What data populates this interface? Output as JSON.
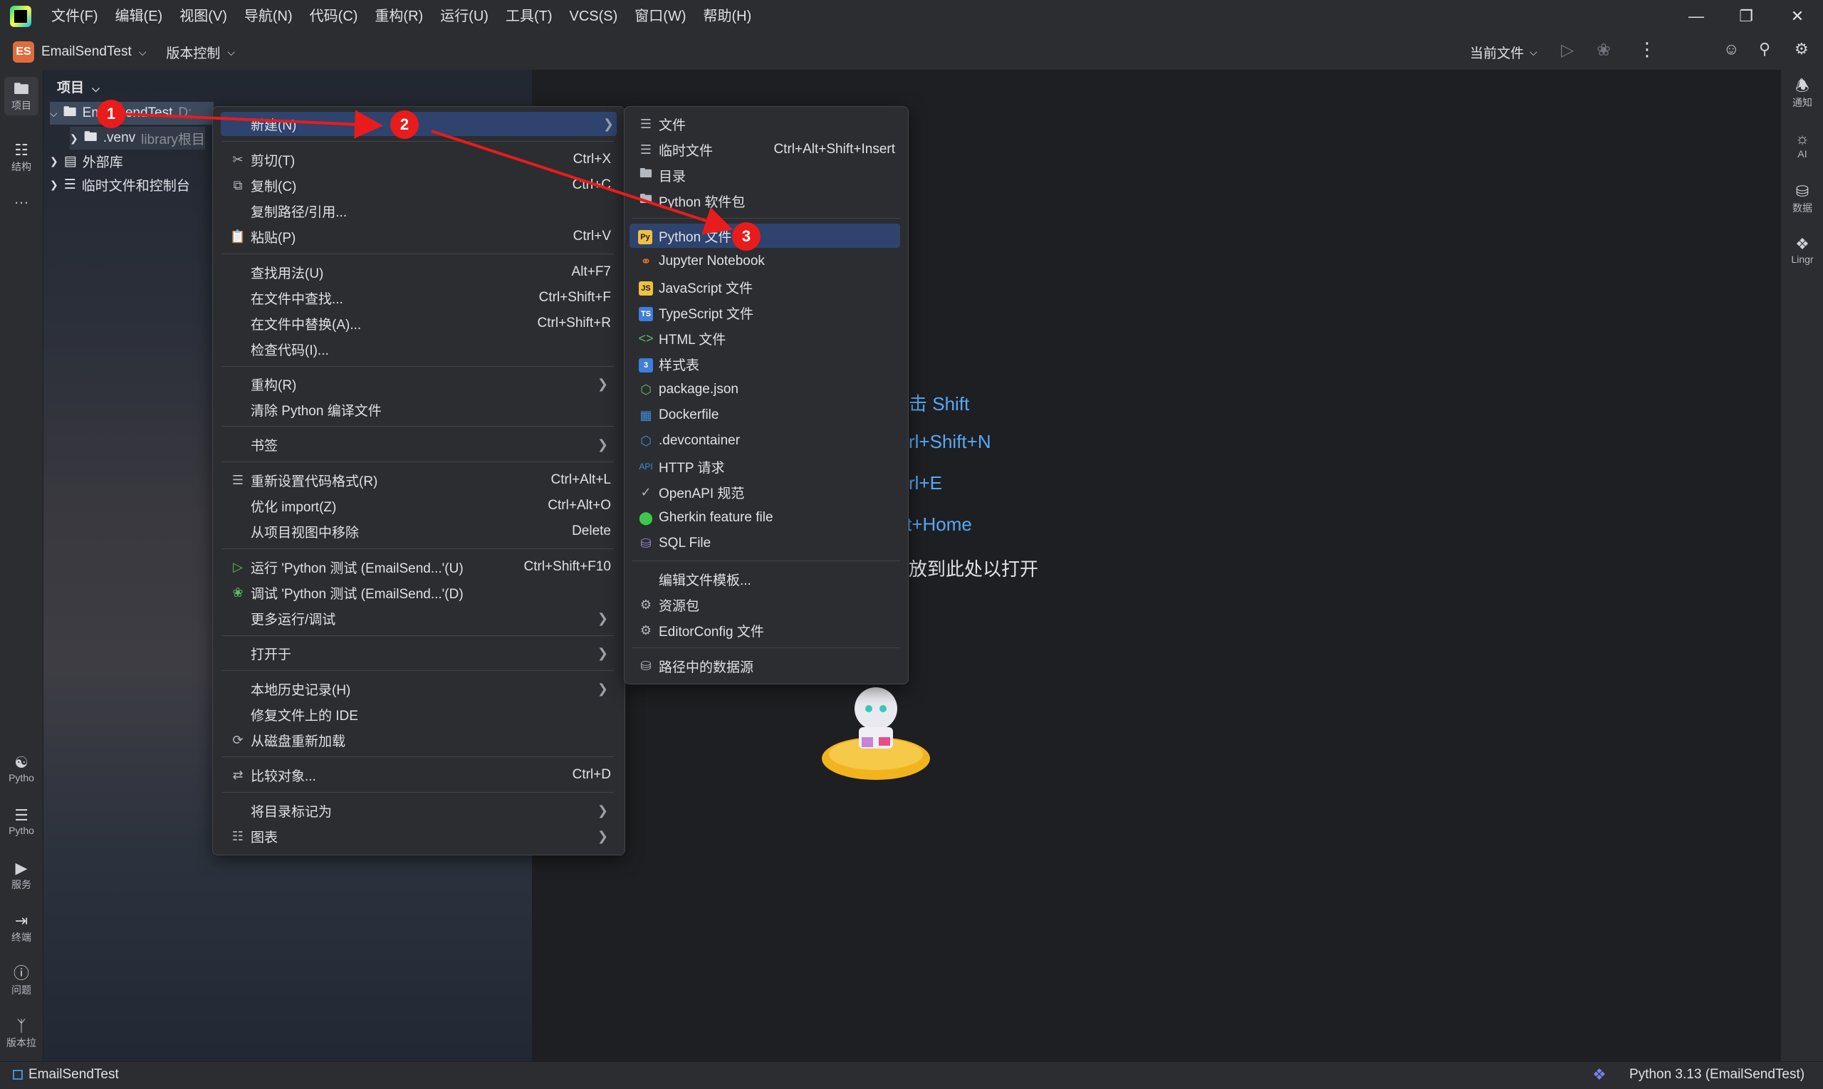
{
  "menubar": {
    "items": [
      "文件(F)",
      "编辑(E)",
      "视图(V)",
      "导航(N)",
      "代码(C)",
      "重构(R)",
      "运行(U)",
      "工具(T)",
      "VCS(S)",
      "窗口(W)",
      "帮助(H)"
    ]
  },
  "toolbar": {
    "project_badge": "ES",
    "project_name": "EmailSendTest",
    "vcs_label": "版本控制",
    "run_config": "当前文件"
  },
  "left_strip": {
    "project": "项目",
    "structure": "结构",
    "more": "…",
    "python_console": "Pytho",
    "python_packages": "Pytho",
    "services": "服务",
    "terminal": "终端",
    "problems": "问题",
    "vcs": "版本拉"
  },
  "right_strip": {
    "notifications": "通知",
    "ai": "AI",
    "database": "数据",
    "lingma": "Lingr"
  },
  "project_panel": {
    "header": "项目",
    "root_name": "EmailSendTest",
    "root_path": "D:",
    "venv_name": ".venv",
    "venv_suffix": "library根目",
    "external_libs": "外部库",
    "scratches": "临时文件和控制台"
  },
  "editor_hints": {
    "line1": "双击 Shift",
    "line2": "Ctrl+Shift+N",
    "line3": "Ctrl+E",
    "line4": "Alt+Home",
    "line5": "拖放到此处以打开"
  },
  "context_menu": {
    "new": "新建(N)",
    "cut": "剪切(T)",
    "cut_sc": "Ctrl+X",
    "copy": "复制(C)",
    "copy_sc": "Ctrl+C",
    "copy_path": "复制路径/引用...",
    "paste": "粘贴(P)",
    "paste_sc": "Ctrl+V",
    "find_usages": "查找用法(U)",
    "find_usages_sc": "Alt+F7",
    "find_in_files": "在文件中查找...",
    "find_in_files_sc": "Ctrl+Shift+F",
    "replace_in_files": "在文件中替换(A)...",
    "replace_in_files_sc": "Ctrl+Shift+R",
    "inspect_code": "检查代码(I)...",
    "refactor": "重构(R)",
    "clean_python": "清除 Python 编译文件",
    "bookmarks": "书签",
    "reformat": "重新设置代码格式(R)",
    "reformat_sc": "Ctrl+Alt+L",
    "optimize_imports": "优化 import(Z)",
    "optimize_imports_sc": "Ctrl+Alt+O",
    "remove_from_view": "从项目视图中移除",
    "remove_from_view_sc": "Delete",
    "run_tests": "运行 'Python 测试 (EmailSend...'(U)",
    "run_tests_sc": "Ctrl+Shift+F10",
    "debug_tests": "调试 'Python 测试 (EmailSend...'(D)",
    "more_run": "更多运行/调试",
    "open_in": "打开于",
    "local_history": "本地历史记录(H)",
    "repair_ide": "修复文件上的 IDE",
    "reload_from_disk": "从磁盘重新加载",
    "compare_with": "比较对象...",
    "compare_with_sc": "Ctrl+D",
    "mark_directory": "将目录标记为",
    "diagrams": "图表"
  },
  "new_submenu": {
    "file": "文件",
    "scratch": "临时文件",
    "scratch_sc": "Ctrl+Alt+Shift+Insert",
    "directory": "目录",
    "python_package": "Python 软件包",
    "python_file": "Python 文件",
    "jupyter": "Jupyter Notebook",
    "javascript": "JavaScript 文件",
    "typescript": "TypeScript 文件",
    "html": "HTML 文件",
    "stylesheet": "样式表",
    "package_json": "package.json",
    "dockerfile": "Dockerfile",
    "devcontainer": ".devcontainer",
    "http_request": "HTTP 请求",
    "openapi": "OpenAPI 规范",
    "gherkin": "Gherkin feature file",
    "sql_file": "SQL File",
    "edit_templates": "编辑文件模板...",
    "resource_bundle": "资源包",
    "editorconfig": "EditorConfig 文件",
    "data_source_path": "路径中的数据源"
  },
  "annotations": {
    "step1": "1",
    "step2": "2",
    "step3": "3",
    "color": "#e81c1c"
  },
  "statusbar": {
    "project": "EmailSendTest",
    "interpreter": "Python 3.13 (EmailSendTest)"
  },
  "colors": {
    "accent": "#56a8f5",
    "highlight": "#2e436e",
    "background": "#1e1f22"
  }
}
